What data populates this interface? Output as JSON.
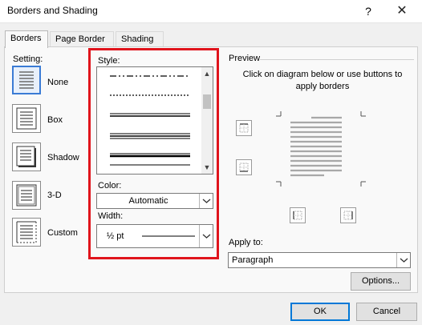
{
  "window": {
    "title": "Borders and Shading",
    "help": "?",
    "close": "✕"
  },
  "tabs": [
    "Borders",
    "Page Border",
    "Shading"
  ],
  "setting": {
    "label": "Setting:",
    "options": [
      "None",
      "Box",
      "Shadow",
      "3-D",
      "Custom"
    ],
    "selected": "None"
  },
  "style": {
    "label": "Style:",
    "up": "▲",
    "down": "▼"
  },
  "color": {
    "label": "Color:",
    "value": "Automatic"
  },
  "width": {
    "label": "Width:",
    "value": "½ pt"
  },
  "preview": {
    "label": "Preview",
    "hint": "Click on diagram below or use buttons to apply borders"
  },
  "apply_to": {
    "label": "Apply to:",
    "value": "Paragraph"
  },
  "buttons": {
    "options": "Options...",
    "ok": "OK",
    "cancel": "Cancel"
  },
  "colors": {
    "highlight": "#e0141c",
    "accent": "#0078d7"
  }
}
